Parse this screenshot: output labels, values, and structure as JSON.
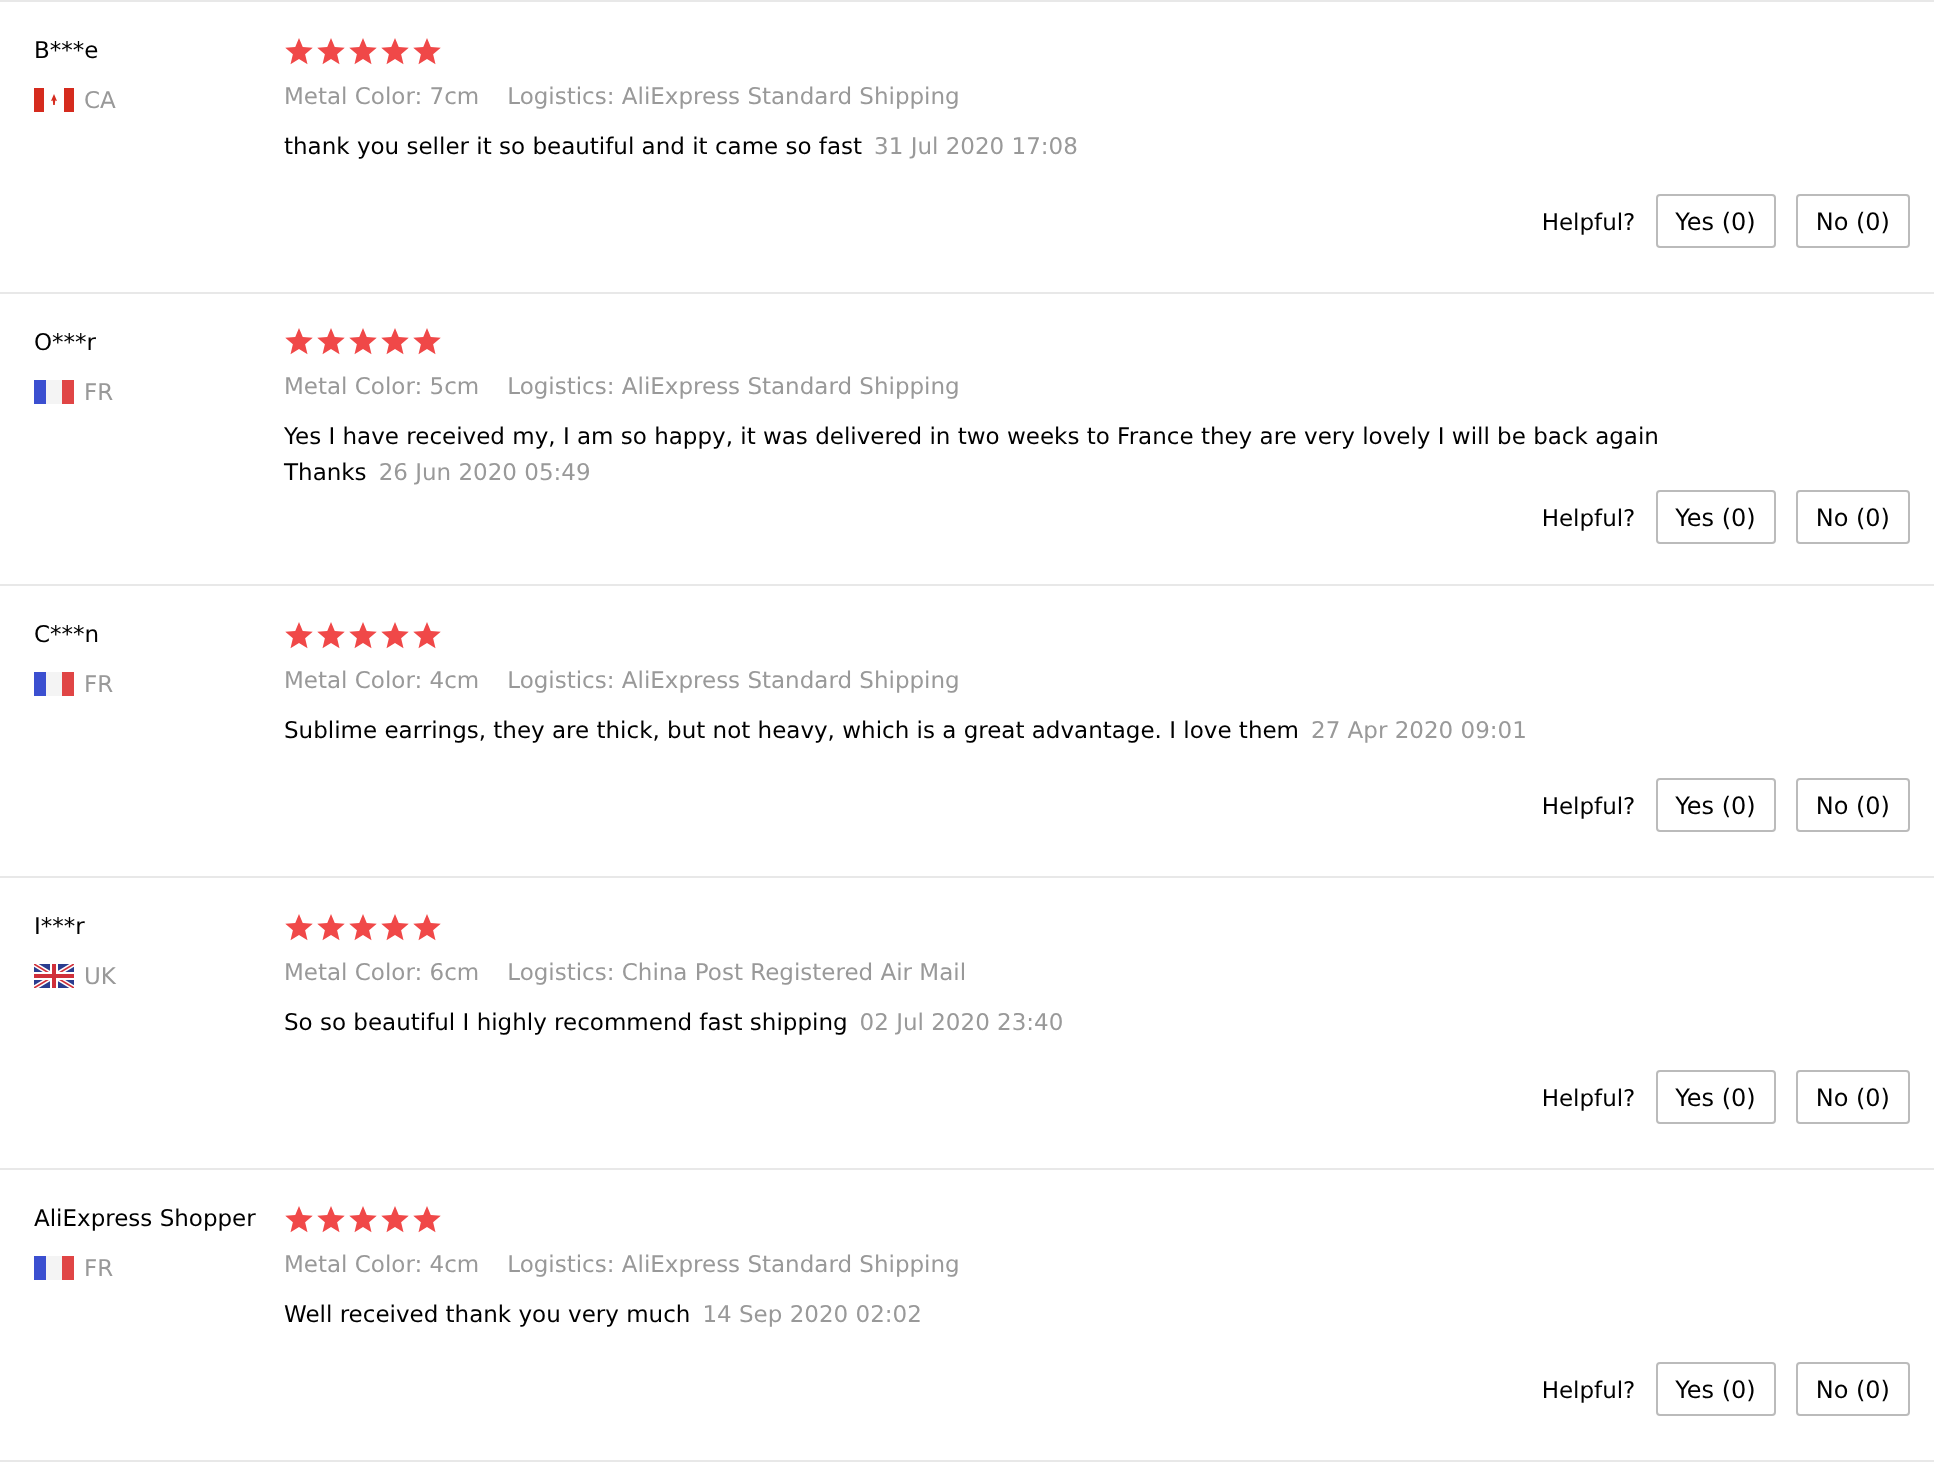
{
  "reviews": [
    {
      "name": "B***e",
      "kind": "canada",
      "country": "CA",
      "stars": 5,
      "color_spec": "Metal Color: 7cm",
      "logistics": "Logistics: AliExpress Standard Shipping",
      "text": "thank you seller it so beautiful and it came so fast",
      "date": "31 Jul 2020 17:08",
      "helpful": "Helpful?",
      "yes": "Yes (0)",
      "no": "No (0)"
    },
    {
      "name": "O***r",
      "kind": "france",
      "country": "FR",
      "stars": 5,
      "color_spec": "Metal Color: 5cm",
      "logistics": "Logistics: AliExpress Standard Shipping",
      "text": "Yes I have received my, I am so happy, it was delivered in two weeks to France they are very lovely I will be back again Thanks",
      "date": "26 Jun 2020 05:49",
      "helpful": "Helpful?",
      "yes": "Yes (0)",
      "no": "No (0)"
    },
    {
      "name": "C***n",
      "kind": "france",
      "country": "FR",
      "stars": 5,
      "color_spec": "Metal Color: 4cm",
      "logistics": "Logistics: AliExpress Standard Shipping",
      "text": "Sublime earrings, they are thick, but not heavy, which is a great advantage. I love them",
      "date": "27 Apr 2020 09:01",
      "helpful": "Helpful?",
      "yes": "Yes (0)",
      "no": "No (0)"
    },
    {
      "name": "I***r",
      "kind": "uk",
      "country": "UK",
      "stars": 5,
      "color_spec": "Metal Color: 6cm",
      "logistics": "Logistics: China Post Registered Air Mail",
      "text": "So so beautiful I highly recommend fast shipping",
      "date": "02 Jul 2020 23:40",
      "helpful": "Helpful?",
      "yes": "Yes (0)",
      "no": "No (0)"
    },
    {
      "name": "AliExpress Shopper",
      "kind": "france",
      "country": "FR",
      "stars": 5,
      "color_spec": "Metal Color: 4cm",
      "logistics": "Logistics: AliExpress Standard Shipping",
      "text": "Well received thank you very much",
      "date": "14 Sep 2020 02:02",
      "helpful": "Helpful?",
      "yes": "Yes (0)",
      "no": "No (0)"
    }
  ]
}
